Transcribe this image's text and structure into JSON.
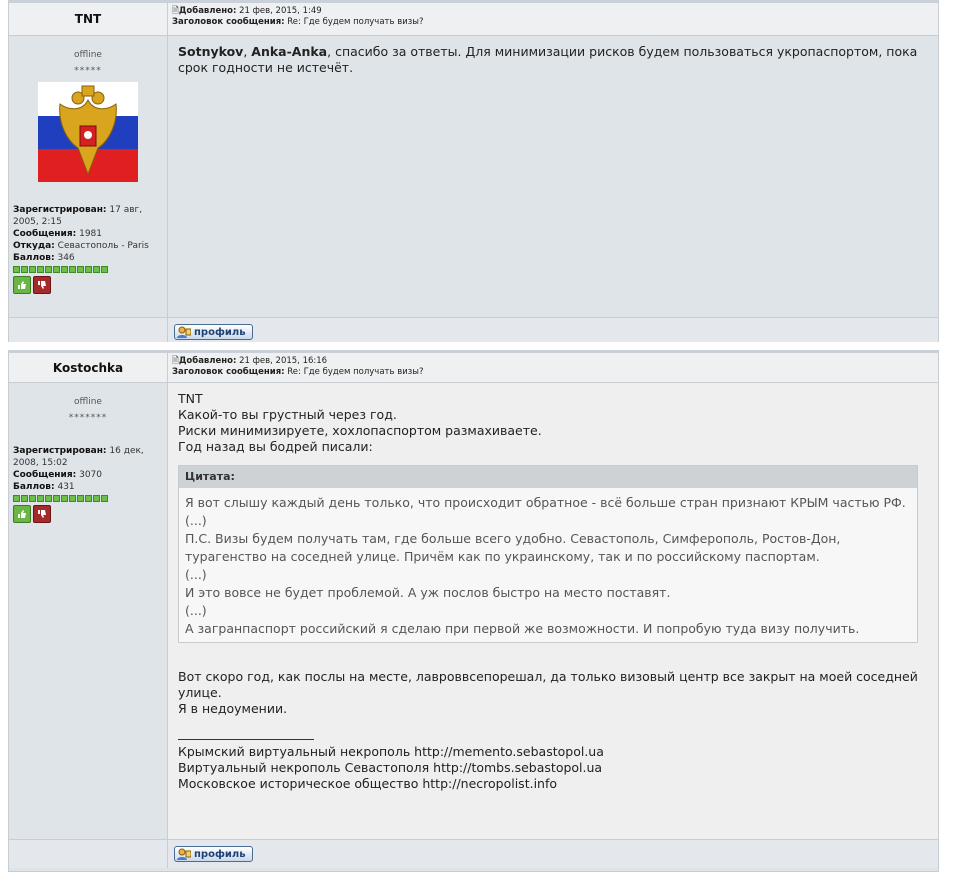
{
  "posts": [
    {
      "author": "TNT",
      "date_label": "Добавлено:",
      "date": "21 фев, 2015, 1:49",
      "subject_label": "Заголовок сообщения:",
      "subject": "Re: Где будем получать визы?",
      "status": "offline",
      "stars": "*****",
      "reg_label": "Зарегистрирован:",
      "reg_value": "17 авг, 2005, 2:15",
      "msgs_label": "Сообщения:",
      "msgs_value": "1981",
      "from_label": "Откуда:",
      "from_value": "Севастополь - Paris",
      "points_label": "Баллов:",
      "points_value": "346",
      "body_bold1": "Sotnykov",
      "body_sep": ", ",
      "body_bold2": "Anka-Anka",
      "body_text": ", спасибо за ответы. Для минимизации рисков будем пользоваться укропаспортом, пока срок годности не истечёт.",
      "profile_button": "профиль"
    },
    {
      "author": "Kostochka",
      "date_label": "Добавлено:",
      "date": "21 фев, 2015, 16:16",
      "subject_label": "Заголовок сообщения:",
      "subject": "Re: Где будем получать визы?",
      "status": "offline",
      "stars": "*******",
      "reg_label": "Зарегистрирован:",
      "reg_value": "16 дек, 2008, 15:02",
      "msgs_label": "Сообщения:",
      "msgs_value": "3070",
      "points_label": "Баллов:",
      "points_value": "431",
      "lines": [
        "TNT",
        "Какой-то вы грустный через год.",
        "Риски минимизируете, хохлопаспортом размахиваете.",
        "Год назад вы бодрей писали:"
      ],
      "quote_label": "Цитата:",
      "quote_lines": [
        "Я вот слышу каждый день только, что происходит обратное - всё больше стран признают КРЫМ частью РФ.",
        "(...)",
        "П.С. Визы будем получать там, где больше всего удобно. Севастополь, Симферополь, Ростов-Дон, турагенство на соседней улице. Причём как по украинскому, так и по российскому паспортам.",
        "(...)",
        "И это вовсе не будет проблемой. А уж послов быстро на место поставят.",
        "(...)",
        "А загранпаспорт российский я сделаю при первой же возможности. И попробую туда визу получить."
      ],
      "after_lines": [
        "Вот скоро год, как послы на месте, лавроввсепорешал, да только визовый центр все закрыт на моей соседней улице.",
        "Я в недоумении."
      ],
      "sig_lines": [
        "Крымский виртуальный некрополь http://memento.sebastopol.ua",
        "Виртуальный некрополь Севастополя http://tombs.sebastopol.ua",
        "Московское историческое общество http://necropolist.info"
      ],
      "profile_button": "профиль"
    }
  ]
}
